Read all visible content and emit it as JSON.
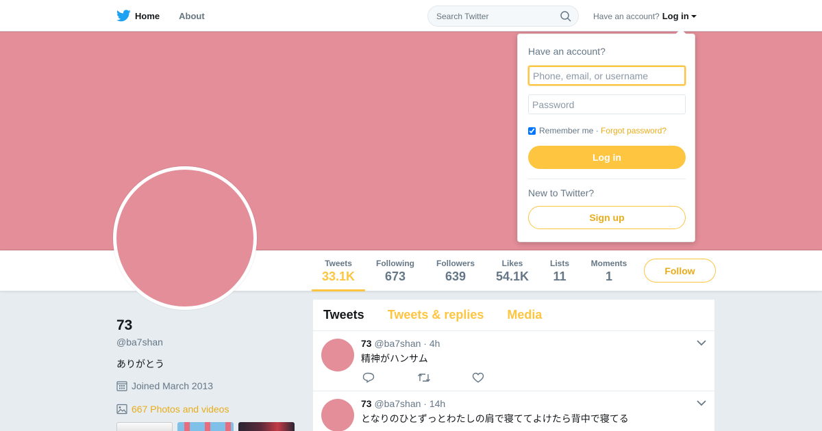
{
  "nav": {
    "home_label": "Home",
    "about_label": "About",
    "search_placeholder": "Search Twitter",
    "account_prompt": "Have an account?",
    "login_label": "Log in"
  },
  "profile": {
    "name": "73",
    "handle": "@ba7shan",
    "bio": "ありがとう",
    "joined": "Joined March 2013",
    "photos_label": "667 Photos and videos"
  },
  "stats": [
    {
      "label": "Tweets",
      "value": "33.1K"
    },
    {
      "label": "Following",
      "value": "673"
    },
    {
      "label": "Followers",
      "value": "639"
    },
    {
      "label": "Likes",
      "value": "54.1K"
    },
    {
      "label": "Lists",
      "value": "11"
    },
    {
      "label": "Moments",
      "value": "1"
    }
  ],
  "follow_label": "Follow",
  "timeline": {
    "tabs": [
      "Tweets",
      "Tweets & replies",
      "Media"
    ],
    "tweets": [
      {
        "name": "73",
        "handle": "@ba7shan",
        "time": "· 4h",
        "text": "精神がハンサム"
      },
      {
        "name": "73",
        "handle": "@ba7shan",
        "time": "· 14h",
        "text": "となりのひとずっとわたしの肩で寝ててよけたら背中で寝てる"
      }
    ]
  },
  "login_dropdown": {
    "heading": "Have an account?",
    "username_placeholder": "Phone, email, or username",
    "password_placeholder": "Password",
    "remember_label": "Remember me ·",
    "forgot_label": "Forgot password?",
    "login_button": "Log in",
    "new_prompt": "New to Twitter?",
    "signup_button": "Sign up"
  },
  "colors": {
    "accent": "#fdc540",
    "banner": "#e38e99",
    "brand_bird": "#1da1f2"
  }
}
